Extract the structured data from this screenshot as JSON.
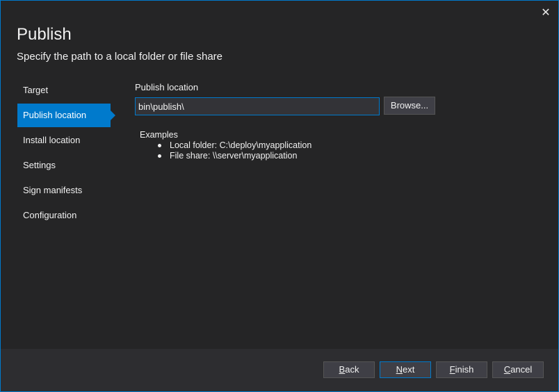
{
  "dialog": {
    "title": "Publish",
    "subtitle": "Specify the path to a local folder or file share",
    "close_icon": "✕"
  },
  "nav": {
    "items": [
      {
        "label": "Target"
      },
      {
        "label": "Publish location",
        "active": true
      },
      {
        "label": "Install location"
      },
      {
        "label": "Settings"
      },
      {
        "label": "Sign manifests"
      },
      {
        "label": "Configuration"
      }
    ]
  },
  "publish_location": {
    "label": "Publish location",
    "value": "bin\\publish\\",
    "browse_label": "Browse..."
  },
  "examples": {
    "title": "Examples",
    "items": [
      "Local folder:  C:\\deploy\\myapplication",
      "File share: \\\\server\\myapplication"
    ]
  },
  "footer": {
    "back": {
      "mnemonic": "B",
      "rest": "ack"
    },
    "next": {
      "mnemonic": "N",
      "rest": "ext"
    },
    "finish": {
      "mnemonic": "F",
      "rest": "inish"
    },
    "cancel": {
      "mnemonic": "C",
      "rest": "ancel"
    }
  },
  "colors": {
    "accent": "#007acc",
    "background": "#252526",
    "footer": "#2d2d30"
  }
}
